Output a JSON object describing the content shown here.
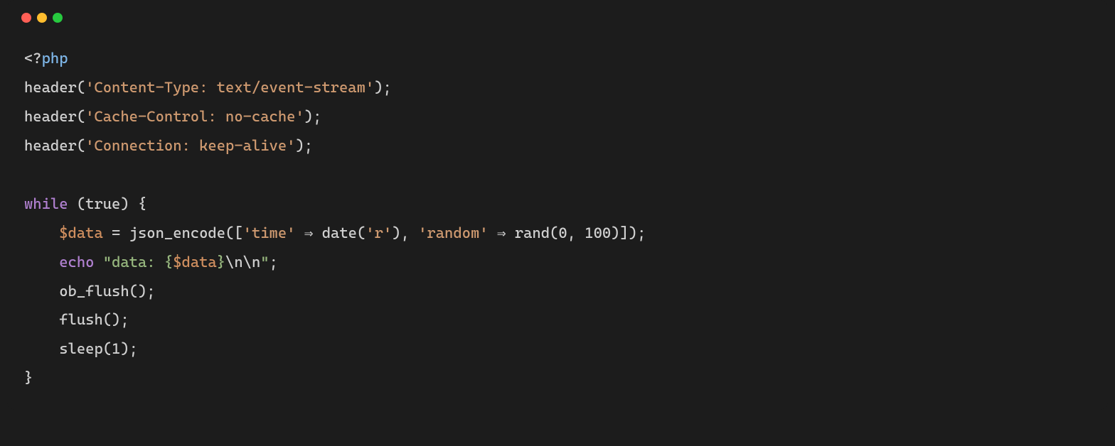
{
  "window": {
    "traffic_lights": {
      "red": "#ff5f56",
      "yellow": "#ffbd2e",
      "green": "#27c93f"
    }
  },
  "code": {
    "language": "php",
    "lines": [
      {
        "type": "php_open",
        "parts": {
          "open": "<?",
          "kw": "php"
        }
      },
      {
        "type": "call",
        "fn": "header",
        "arg_str": "'Content-Type: text/event-stream'",
        "tail": ");"
      },
      {
        "type": "call",
        "fn": "header",
        "arg_str": "'Cache-Control: no-cache'",
        "tail": ");"
      },
      {
        "type": "call",
        "fn": "header",
        "arg_str": "'Connection: keep-alive'",
        "tail": ");"
      },
      {
        "type": "blank"
      },
      {
        "type": "while_open",
        "kw": "while",
        "cond": "true",
        "brace": "{"
      },
      {
        "type": "assign",
        "indent": "    ",
        "var": "$data",
        "eq": " = ",
        "fn": "json_encode",
        "open": "([",
        "k1": "'time'",
        "arrow": " ⇒ ",
        "v1fn": "date",
        "v1arg": "'r'",
        "sep": ", ",
        "k2": "'random'",
        "v2fn": "rand",
        "v2args_open": "(",
        "v2a": "0",
        "v2comma": ", ",
        "v2b": "100",
        "v2args_close": ")",
        "close": "]);"
      },
      {
        "type": "echo",
        "indent": "    ",
        "kw": "echo",
        "space": " ",
        "q": "\"",
        "lit1": "data: {",
        "interp": "$data",
        "lit2": "}",
        "esc": "\\n\\n",
        "q2": "\"",
        "tail": ";"
      },
      {
        "type": "stmt",
        "indent": "    ",
        "text": "ob_flush();"
      },
      {
        "type": "stmt",
        "indent": "    ",
        "text": "flush();"
      },
      {
        "type": "sleep",
        "indent": "    ",
        "fn": "sleep",
        "open": "(",
        "arg": "1",
        "close": ");"
      },
      {
        "type": "close_brace",
        "text": "}"
      }
    ]
  }
}
